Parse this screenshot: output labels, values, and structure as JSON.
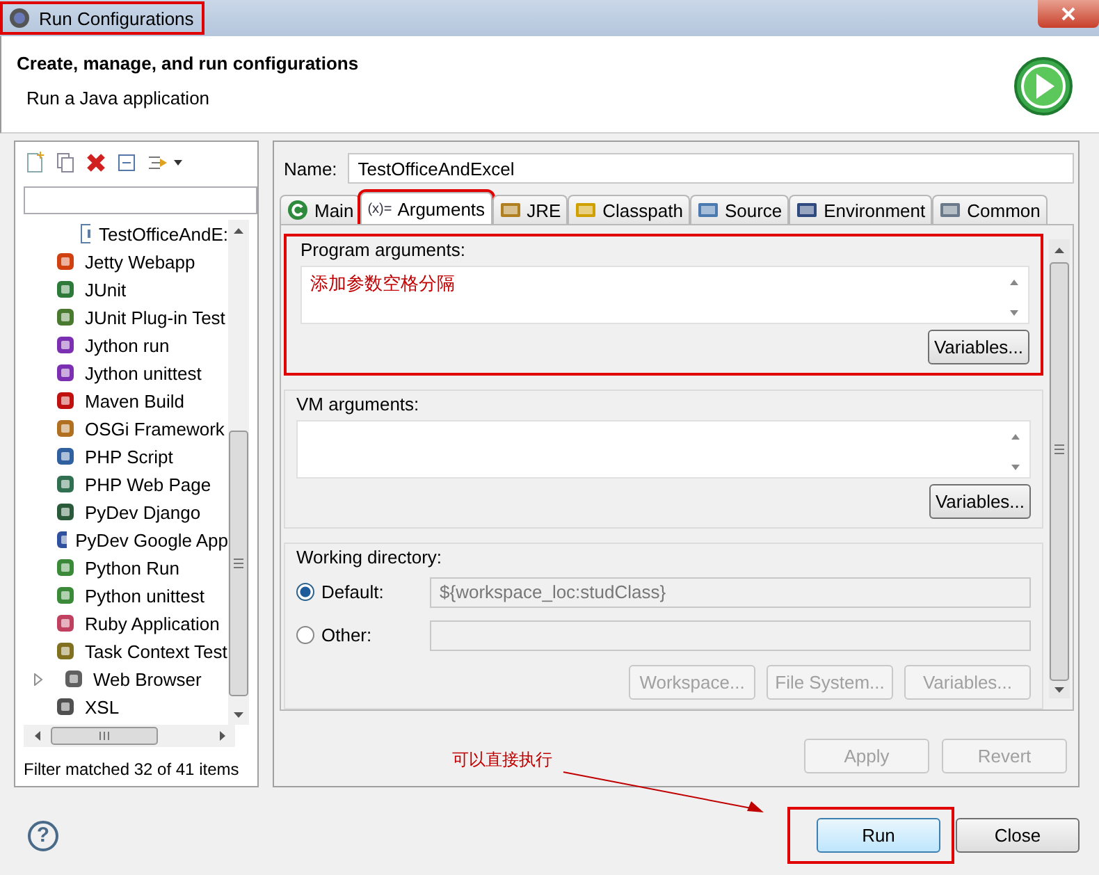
{
  "window": {
    "title": "Run Configurations",
    "highlighted": true
  },
  "header": {
    "title": "Create, manage, and run configurations",
    "subtitle": "Run a Java application"
  },
  "sidebar": {
    "items": [
      {
        "label": "TestOfficeAndE:",
        "kind": "config"
      },
      {
        "label": "Jetty Webapp",
        "kind": "type"
      },
      {
        "label": "JUnit",
        "kind": "type"
      },
      {
        "label": "JUnit Plug-in Test",
        "kind": "type"
      },
      {
        "label": "Jython run",
        "kind": "type"
      },
      {
        "label": "Jython unittest",
        "kind": "type"
      },
      {
        "label": "Maven Build",
        "kind": "type"
      },
      {
        "label": "OSGi Framework",
        "kind": "type"
      },
      {
        "label": "PHP Script",
        "kind": "type"
      },
      {
        "label": "PHP Web Page",
        "kind": "type"
      },
      {
        "label": "PyDev Django",
        "kind": "type"
      },
      {
        "label": "PyDev Google App",
        "kind": "type"
      },
      {
        "label": "Python Run",
        "kind": "type"
      },
      {
        "label": "Python unittest",
        "kind": "type"
      },
      {
        "label": "Ruby Application",
        "kind": "type"
      },
      {
        "label": "Task Context Test",
        "kind": "type"
      },
      {
        "label": "Web Browser",
        "kind": "collapsed"
      },
      {
        "label": "XSL",
        "kind": "type"
      }
    ],
    "status": "Filter matched 32 of 41 items"
  },
  "editor": {
    "name_label": "Name:",
    "name_value": "TestOfficeAndExcel",
    "tabs": [
      {
        "label": "Main",
        "selected": false,
        "highlighted": false
      },
      {
        "label": "Arguments",
        "glyph": "(x)=",
        "selected": true,
        "highlighted": true
      },
      {
        "label": "JRE",
        "selected": false,
        "highlighted": false
      },
      {
        "label": "Classpath",
        "selected": false,
        "highlighted": false
      },
      {
        "label": "Source",
        "selected": false,
        "highlighted": false
      },
      {
        "label": "Environment",
        "selected": false,
        "highlighted": false
      },
      {
        "label": "Common",
        "selected": false,
        "highlighted": false
      }
    ],
    "program_arguments": {
      "label": "Program arguments:",
      "value": "添加参数空格分隔",
      "button": "Variables...",
      "highlighted": true
    },
    "vm_arguments": {
      "label": "VM arguments:",
      "button": "Variables..."
    },
    "working_directory": {
      "label": "Working directory:",
      "options": [
        {
          "label": "Default:",
          "selected": true,
          "value": "${workspace_loc:studClass}"
        },
        {
          "label": "Other:",
          "selected": false
        }
      ],
      "buttons": [
        {
          "label": "Workspace...",
          "disabled": true
        },
        {
          "label": "File System...",
          "disabled": true
        },
        {
          "label": "Variables...",
          "disabled": true
        }
      ]
    },
    "buttons": [
      {
        "label": "Apply",
        "disabled": true
      },
      {
        "label": "Revert",
        "disabled": true
      }
    ]
  },
  "footer": {
    "help": "?",
    "buttons": [
      {
        "label": "Run",
        "default": true,
        "highlighted": true
      },
      {
        "label": "Close",
        "default": false,
        "highlighted": false
      }
    ]
  },
  "annotation": {
    "text": "可以直接执行"
  }
}
